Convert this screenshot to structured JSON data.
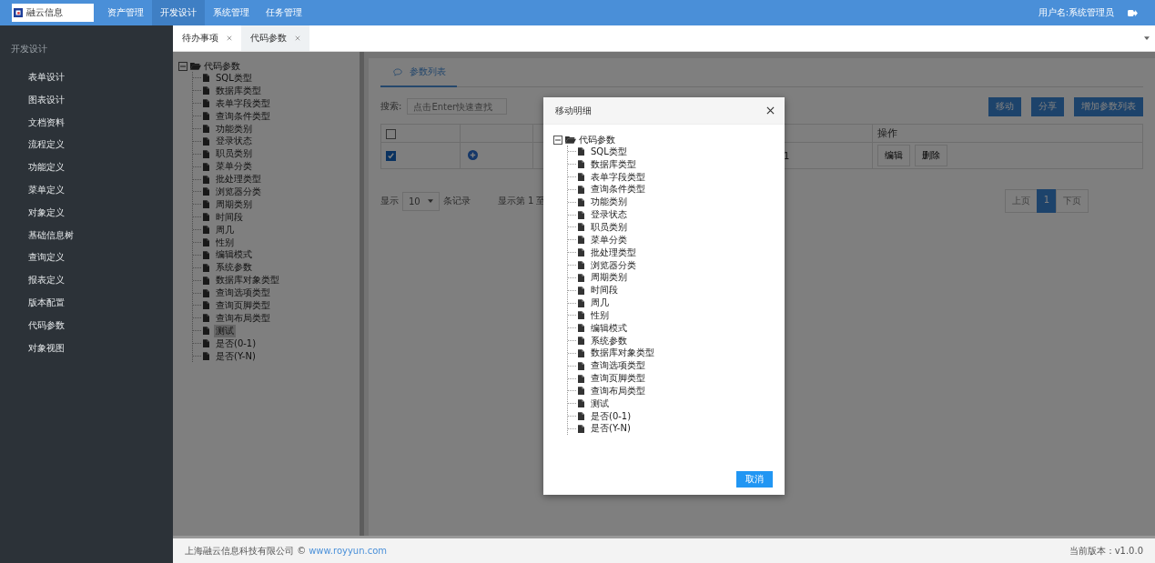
{
  "header": {
    "logo_text": "融云信息",
    "nav": [
      {
        "label": "资产管理",
        "selected": false
      },
      {
        "label": "开发设计",
        "selected": true
      },
      {
        "label": "系统管理",
        "selected": false
      },
      {
        "label": "任务管理",
        "selected": false
      }
    ],
    "user": "用户名:系统管理员"
  },
  "sidebar": {
    "section": "开发设计",
    "items": [
      "表单设计",
      "图表设计",
      "文档资料",
      "流程定义",
      "功能定义",
      "菜单定义",
      "对象定义",
      "基础信息树",
      "查询定义",
      "报表定义",
      "版本配置",
      "代码参数",
      "对象视图"
    ]
  },
  "tabs": [
    {
      "label": "待办事项",
      "selected": false
    },
    {
      "label": "代码参数",
      "selected": true
    }
  ],
  "tree": {
    "root": "代码参数",
    "expanded": true,
    "children": [
      {
        "label": "SQL类型",
        "selected": false
      },
      {
        "label": "数据库类型",
        "selected": false
      },
      {
        "label": "表单字段类型",
        "selected": false
      },
      {
        "label": "查询条件类型",
        "selected": false
      },
      {
        "label": "功能类别",
        "selected": false
      },
      {
        "label": "登录状态",
        "selected": false
      },
      {
        "label": "职员类别",
        "selected": false
      },
      {
        "label": "菜单分类",
        "selected": false
      },
      {
        "label": "批处理类型",
        "selected": false
      },
      {
        "label": "浏览器分类",
        "selected": false
      },
      {
        "label": "周期类别",
        "selected": false
      },
      {
        "label": "时间段",
        "selected": false
      },
      {
        "label": "周几",
        "selected": false
      },
      {
        "label": "性别",
        "selected": false
      },
      {
        "label": "编辑模式",
        "selected": false
      },
      {
        "label": "系统参数",
        "selected": false
      },
      {
        "label": "数据库对象类型",
        "selected": false
      },
      {
        "label": "查询选项类型",
        "selected": false
      },
      {
        "label": "查询页脚类型",
        "selected": false
      },
      {
        "label": "查询布局类型",
        "selected": false
      },
      {
        "label": "测试",
        "selected": true
      },
      {
        "label": "是否(0-1)",
        "selected": false
      },
      {
        "label": "是否(Y-N)",
        "selected": false
      }
    ]
  },
  "panel": {
    "tab": "参数列表",
    "search_label": "搜索:",
    "search_placeholder": "点击Enter快速查找",
    "buttons": [
      "移动",
      "分享",
      "增加参数列表"
    ],
    "table": {
      "columns": [
        {
          "kind": "check",
          "checked": false
        },
        {
          "kind": "blank"
        },
        {
          "kind": "blank"
        },
        {
          "kind": "blank"
        },
        {
          "label": "操作",
          "kind": "text"
        }
      ],
      "rows": [
        {
          "checked": true,
          "value": "1",
          "actions": [
            "编辑",
            "删除"
          ]
        }
      ]
    },
    "page_size_label": "显示",
    "page_size": "10",
    "records_label": "条记录",
    "info": "显示第 1 至",
    "pager": [
      {
        "label": "上页",
        "selected": false
      },
      {
        "label": "1",
        "selected": true
      },
      {
        "label": "下页",
        "selected": false
      }
    ]
  },
  "modal": {
    "title": "移动明细",
    "tree": {
      "root": "代码参数",
      "expanded": true,
      "children": [
        "SQL类型",
        "数据库类型",
        "表单字段类型",
        "查询条件类型",
        "功能类别",
        "登录状态",
        "职员类别",
        "菜单分类",
        "批处理类型",
        "浏览器分类",
        "周期类别",
        "时间段",
        "周几",
        "性别",
        "编辑模式",
        "系统参数",
        "数据库对象类型",
        "查询选项类型",
        "查询页脚类型",
        "查询布局类型",
        "测试",
        "是否(0-1)",
        "是否(Y-N)"
      ]
    },
    "cancel": "取消"
  },
  "footer": {
    "company": "上海融云信息科技有限公司 ©",
    "link": "www.royyun.com",
    "version": "当前版本：v1.0.0"
  }
}
